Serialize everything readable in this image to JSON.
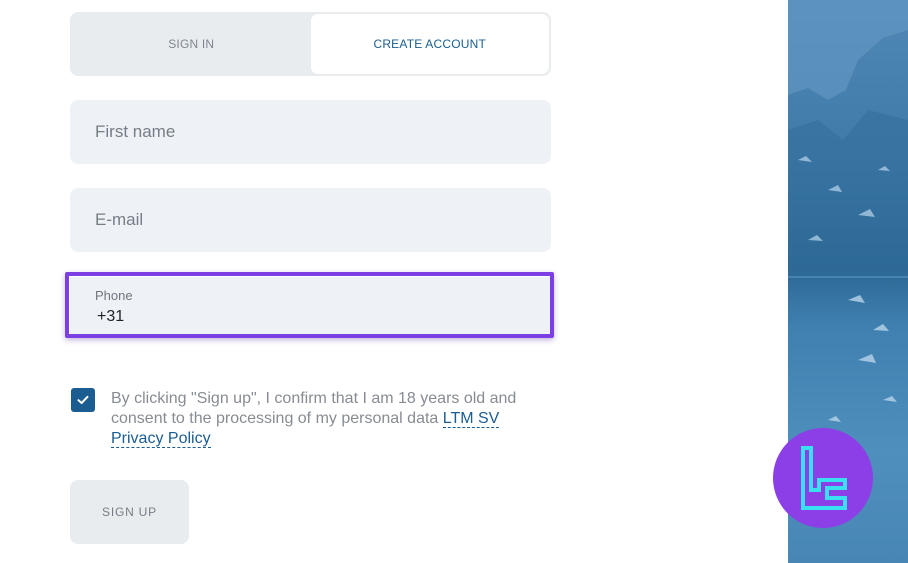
{
  "tabs": {
    "sign_in": "SIGN IN",
    "create_account": "CREATE ACCOUNT",
    "active": "create_account"
  },
  "form": {
    "first_name_placeholder": "First name",
    "email_placeholder": "E-mail",
    "phone_label": "Phone",
    "phone_value": "+31",
    "consent_text": "By clicking \"Sign up\", I confirm that I am 18 years old and consent to the processing of my personal data ",
    "consent_link": "LTM SV Privacy Policy",
    "consent_checked": true,
    "submit_label": "SIGN UP"
  },
  "colors": {
    "accent": "#1b5c91",
    "highlight_border": "#7b3fe4",
    "field_bg": "#eef2f6",
    "logo_bg": "#8c3fe6",
    "logo_fg": "#39e0f0"
  },
  "icons": {
    "checkbox": "check-icon",
    "logo": "tc-logo-icon"
  }
}
